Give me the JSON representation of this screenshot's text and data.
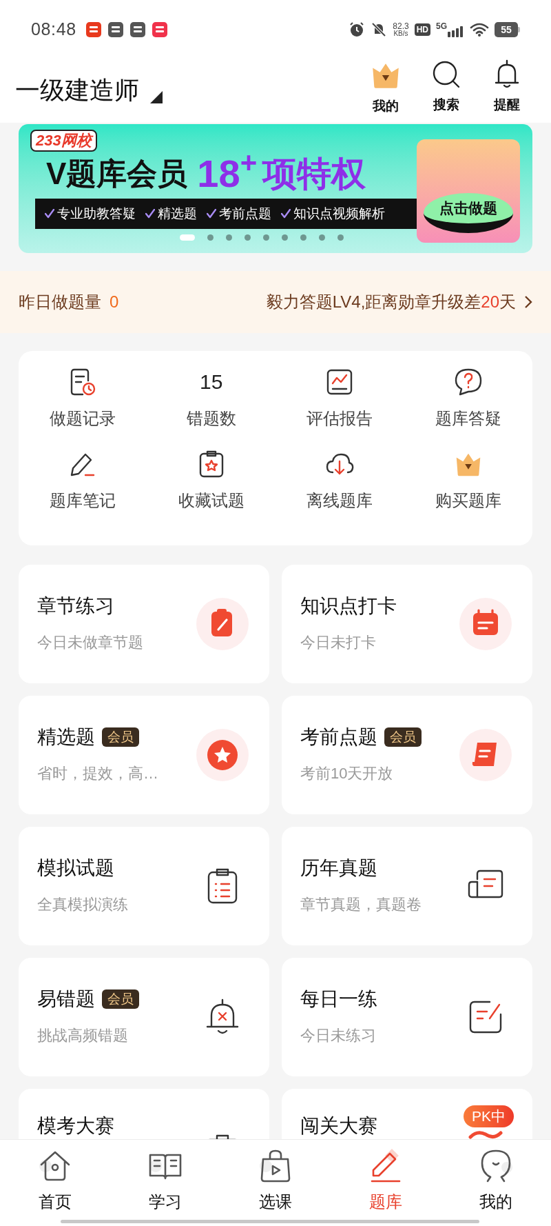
{
  "status_bar": {
    "time": "08:48",
    "speed_value": "82.3",
    "speed_unit": "KB/s",
    "hd": "HD",
    "network": "5G",
    "battery": "55"
  },
  "header": {
    "title": "一级建造师",
    "actions": [
      {
        "label": "我的",
        "kind": "crown"
      },
      {
        "label": "搜索",
        "kind": "search"
      },
      {
        "label": "提醒",
        "kind": "bell"
      }
    ]
  },
  "banner": {
    "logo": "233网校",
    "headline": "V题库会员",
    "number": "18",
    "number_sup": "+",
    "headline_suffix": "项特权",
    "features": [
      "专业助教答疑",
      "精选题",
      "考前点题",
      "知识点视频解析"
    ],
    "cta": "点击做题",
    "pages": [
      {
        "selected": true
      },
      {
        "selected": false
      },
      {
        "selected": false
      },
      {
        "selected": false
      },
      {
        "selected": false
      },
      {
        "selected": false
      },
      {
        "selected": false
      },
      {
        "selected": false
      },
      {
        "selected": false
      }
    ]
  },
  "notice": {
    "label": "昨日做题量",
    "value": "0",
    "prefix": "毅力答题LV4,距离勋章升级差",
    "highlight": "20",
    "suffix": "天"
  },
  "tools": [
    {
      "label": "做题记录",
      "kind": "record"
    },
    {
      "label": "错题数",
      "kind": "count",
      "value": "15"
    },
    {
      "label": "评估报告",
      "kind": "report"
    },
    {
      "label": "题库答疑",
      "kind": "question"
    },
    {
      "label": "题库笔记",
      "kind": "note"
    },
    {
      "label": "收藏试题",
      "kind": "favorite"
    },
    {
      "label": "离线题库",
      "kind": "download"
    },
    {
      "label": "购买题库",
      "kind": "crown"
    }
  ],
  "practice": [
    {
      "title": "章节练习",
      "subtitle": "今日未做章节题",
      "kind": "clipboard"
    },
    {
      "title": "知识点打卡",
      "subtitle": "今日未打卡",
      "kind": "calendar"
    },
    {
      "title": "精选题",
      "badge": "会员",
      "subtitle": "省时，提效，高…",
      "kind": "star"
    },
    {
      "title": "考前点题",
      "badge": "会员",
      "subtitle": "考前10天开放",
      "kind": "scroll"
    },
    {
      "title": "模拟试题",
      "subtitle": "全真模拟演练",
      "kind": "list"
    },
    {
      "title": "历年真题",
      "subtitle": "章节真题，真题卷",
      "kind": "document"
    },
    {
      "title": "易错题",
      "badge": "会员",
      "subtitle": "挑战高频错题",
      "kind": "alarm"
    },
    {
      "title": "每日一练",
      "subtitle": "今日未练习",
      "kind": "edit"
    },
    {
      "title": "模考大赛",
      "kind": "briefcase"
    },
    {
      "title": "闯关大赛",
      "tag": "PK中",
      "kind": "flag"
    }
  ],
  "tab_bar": [
    {
      "label": "首页",
      "kind": "home",
      "selected": false
    },
    {
      "label": "学习",
      "kind": "book",
      "selected": false
    },
    {
      "label": "选课",
      "kind": "bag",
      "selected": false
    },
    {
      "label": "题库",
      "kind": "pencil",
      "selected": true
    },
    {
      "label": "我的",
      "kind": "face",
      "selected": false
    }
  ]
}
